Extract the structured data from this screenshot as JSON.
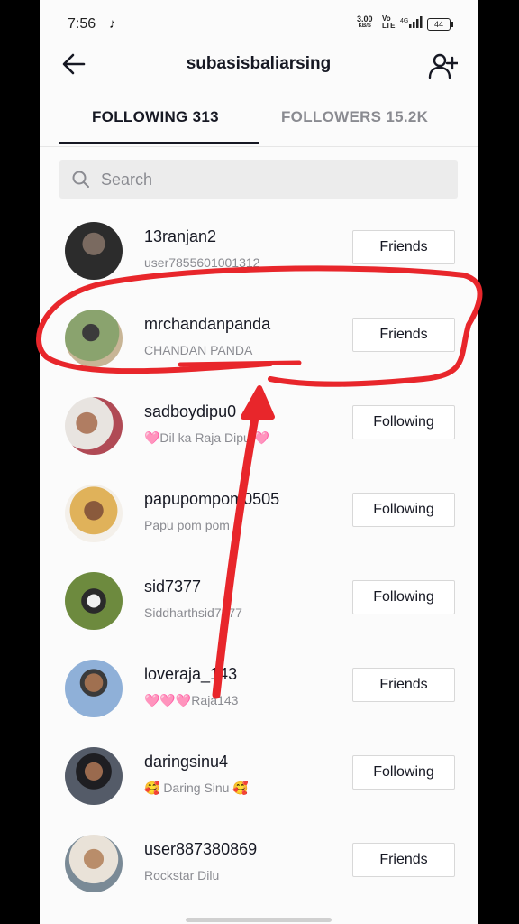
{
  "status_bar": {
    "time": "7:56",
    "net_speed": "3.00",
    "net_unit": "KB/S",
    "volte": "Vo LTE",
    "network": "4G",
    "battery": "44"
  },
  "header": {
    "title": "subasisbaliarsing"
  },
  "tabs": {
    "following": "FOLLOWING 313",
    "followers": "FOLLOWERS 15.2K"
  },
  "search": {
    "placeholder": "Search"
  },
  "users": [
    {
      "username": "13ranjan2",
      "nickname": "user7855601001312",
      "button": "Friends",
      "avatar_color": "#3a3a3a"
    },
    {
      "username": "mrchandanpanda",
      "nickname": "CHANDAN PANDA",
      "button": "Friends",
      "avatar_color": "#6f8a55"
    },
    {
      "username": "sadboydipu0",
      "nickname": "🩷Dil ka Raja Dipu 🩷",
      "button": "Following",
      "avatar_color": "#c9a089"
    },
    {
      "username": "papupompom0505",
      "nickname": "Papu pom pom",
      "button": "Following",
      "avatar_color": "#c88a3d"
    },
    {
      "username": "sid7377",
      "nickname": "Siddharthsid7377",
      "button": "Following",
      "avatar_color": "#59703a"
    },
    {
      "username": "loveraja_143",
      "nickname": "🩷🩷🩷Raja143",
      "button": "Friends",
      "avatar_color": "#5f86c0"
    },
    {
      "username": "daringsinu4",
      "nickname": "🥰 Daring Sinu 🥰",
      "button": "Following",
      "avatar_color": "#4a4f5a"
    },
    {
      "username": "user887380869",
      "nickname": "Rockstar Dilu",
      "button": "Friends",
      "avatar_color": "#a5805f"
    }
  ],
  "colors": {
    "annotation": "#e8262b",
    "text_primary": "#161823",
    "text_secondary": "#8a8b91"
  }
}
